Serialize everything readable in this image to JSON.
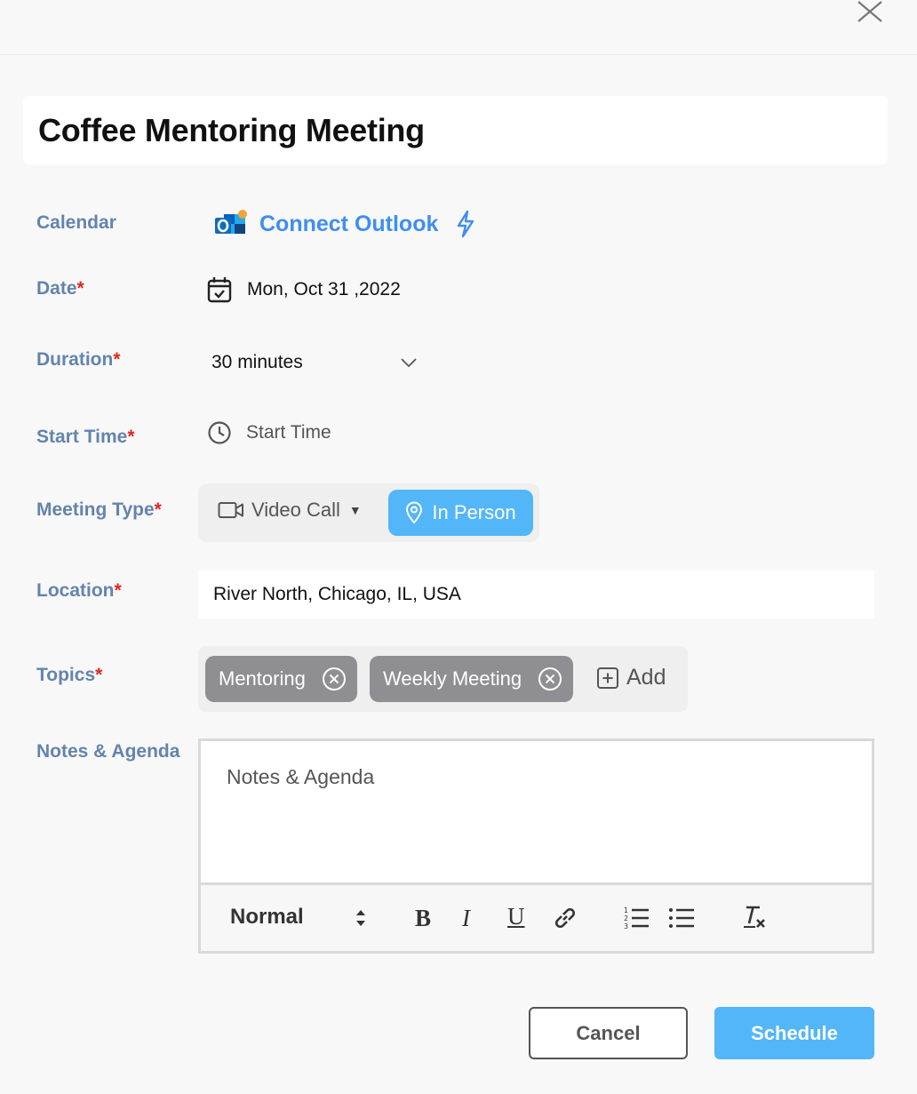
{
  "header": {
    "close_icon": "close-icon"
  },
  "meeting": {
    "title": "Coffee Mentoring Meeting"
  },
  "labels": {
    "calendar": "Calendar",
    "date": "Date",
    "duration": "Duration",
    "start_time": "Start Time",
    "meeting_type": "Meeting Type",
    "location": "Location",
    "topics": "Topics",
    "notes": "Notes & Agenda",
    "required_mark": "*"
  },
  "calendar": {
    "connect_label": "Connect Outlook",
    "icon": "outlook-icon",
    "action_icon": "bolt-icon"
  },
  "date": {
    "value": "Mon, Oct 31 ,2022",
    "icon": "calendar-check-icon"
  },
  "duration": {
    "value": "30 minutes",
    "icon": "chevron-down-icon"
  },
  "start_time": {
    "placeholder": "Start Time",
    "icon": "clock-icon"
  },
  "meeting_type": {
    "options": [
      {
        "label": "Video Call",
        "icon": "video-camera-icon",
        "selected": false,
        "caret": "▼"
      },
      {
        "label": "In Person",
        "icon": "map-pin-icon",
        "selected": true
      }
    ]
  },
  "location": {
    "value": "River North, Chicago, IL, USA"
  },
  "topics": {
    "chips": [
      {
        "label": "Mentoring"
      },
      {
        "label": "Weekly Meeting"
      }
    ],
    "add_label": "Add"
  },
  "notes": {
    "placeholder": "Notes & Agenda",
    "toolbar": {
      "format_label": "Normal",
      "bold": "B",
      "italic": "I",
      "underline": "U"
    }
  },
  "actions": {
    "cancel_label": "Cancel",
    "schedule_label": "Schedule"
  },
  "colors": {
    "accent": "#53b6f8",
    "link": "#3e8ef0",
    "label": "#6384ad",
    "required": "#e0281e",
    "chip": "#8f8f93"
  }
}
